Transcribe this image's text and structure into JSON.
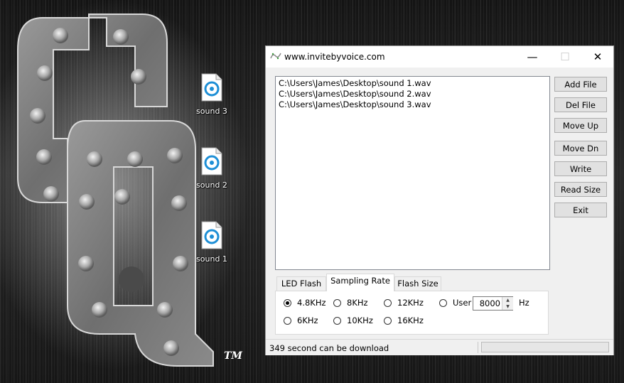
{
  "window": {
    "title": "www.invitebyvoice.com",
    "controls": {
      "minimize": "—",
      "maximize": "☐",
      "close": "✕"
    }
  },
  "file_list": [
    "C:\\Users\\James\\Desktop\\sound 1.wav",
    "C:\\Users\\James\\Desktop\\sound 2.wav",
    "C:\\Users\\James\\Desktop\\sound 3.wav"
  ],
  "buttons": {
    "add_file": "Add File",
    "del_file": "Del File",
    "move_up": "Move Up",
    "move_dn": "Move Dn",
    "write": "Write",
    "read_size": "Read Size",
    "exit": "Exit"
  },
  "tabs": [
    "LED Flash",
    "Sampling Rate",
    "Flash Size"
  ],
  "active_tab": "Sampling Rate",
  "sampling_rate": {
    "options": [
      "4.8KHz",
      "8KHz",
      "12KHz",
      "User",
      "6KHz",
      "10KHz",
      "16KHz"
    ],
    "selected": "4.8KHz",
    "user_value": "8000",
    "unit": "Hz"
  },
  "status": {
    "message": "349 second can be download",
    "progress": 0
  },
  "desktop_icons": [
    "sound 3",
    "sound 2",
    "sound 1"
  ],
  "logo": {
    "trademark": "TM"
  },
  "colors": {
    "desktop_bg": "#1f1f1f",
    "window_bg": "#f0f0f0",
    "accent": "#0078d7",
    "button_bg": "#e1e1e1"
  }
}
